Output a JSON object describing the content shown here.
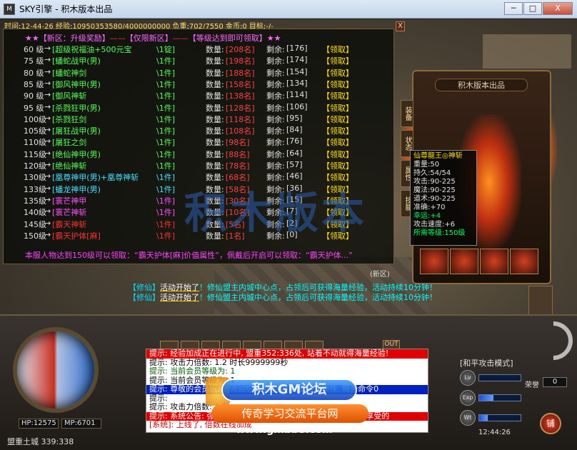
{
  "window": {
    "title": "SKY引擎 - 积木版本出品",
    "min": "─",
    "max": "□",
    "close": "X"
  },
  "status": {
    "time_label": "时间",
    "time": "12-44-26",
    "exp_label": "经验",
    "exp": "10950353580/4000000000",
    "weight_label": "负重",
    "weight": "702/7550",
    "gold_label": "金币",
    "gold": "0",
    "target_label": "目标",
    "target": "-/-"
  },
  "panel": {
    "close": "X",
    "header_star1": "★★",
    "header_a": "【新区：升级奖励】",
    "header_dash1": "——",
    "header_b": "【仅限新区】",
    "header_dash2": "——",
    "header_c": "【等级达到即可领取】",
    "header_star2": "★★",
    "count_label": "数量:",
    "remain_label": "剩余:",
    "rows": [
      {
        "lv": "60 级",
        "item": "[超级祝福油+500元宝",
        "qty": "\\1锭]",
        "cnt": "[208名]",
        "rem": "[176]",
        "claim": "【领取】",
        "color": "#50ff50"
      },
      {
        "lv": "75 级",
        "item": "[蟠蛇战甲(男)",
        "qty": "\\1件]",
        "cnt": "[198名]",
        "rem": "[174]",
        "claim": "【领取】",
        "color": "#50ff50"
      },
      {
        "lv": "80 级",
        "item": "[蟠蛇神剑",
        "qty": "\\1件]",
        "cnt": "[188名]",
        "rem": "[154]",
        "claim": "【领取】",
        "color": "#50ff50"
      },
      {
        "lv": "85 级",
        "item": "[御风神甲(男)",
        "qty": "\\1件]",
        "cnt": "[158名]",
        "rem": "[134]",
        "claim": "【领取】",
        "color": "#50ff50"
      },
      {
        "lv": "90 级",
        "item": "[御风神斩",
        "qty": "\\1件]",
        "cnt": "[138名]",
        "rem": "[114]",
        "claim": "【领取】",
        "color": "#50ff50"
      },
      {
        "lv": "95 级",
        "item": "[杀戮狂甲(男)",
        "qty": "\\1件]",
        "cnt": "[128名]",
        "rem": "[106]",
        "claim": "【领取】",
        "color": "#50ff50"
      },
      {
        "lv": "100级",
        "item": "[杀戮狂剑",
        "qty": "\\1件]",
        "cnt": "[118名]",
        "rem": "[95]",
        "claim": "【领取】",
        "color": "#50ff50"
      },
      {
        "lv": "105级",
        "item": "[屠狂战甲(男)",
        "qty": "\\1件]",
        "cnt": "[108名]",
        "rem": "[84]",
        "claim": "【领取】",
        "color": "#50ff50"
      },
      {
        "lv": "110级",
        "item": "[屠狂之剑",
        "qty": "\\1件]",
        "cnt": "[98名]",
        "rem": "[76]",
        "claim": "【领取】",
        "color": "#50ff50"
      },
      {
        "lv": "115级",
        "item": "[绝仙神甲(男)",
        "qty": "\\1件]",
        "cnt": "[88名]",
        "rem": "[64]",
        "claim": "【领取】",
        "color": "#50ff50"
      },
      {
        "lv": "120级",
        "item": "[绝仙神斩",
        "qty": "\\1件]",
        "cnt": "[78名]",
        "rem": "[57]",
        "claim": "【领取】",
        "color": "#50ff50"
      },
      {
        "lv": "130级",
        "item": "[凰尊神甲(男)+凰尊神斩",
        "qty": "\\1件]",
        "cnt": "[68名]",
        "rem": "[46]",
        "claim": "【领取】",
        "color": "#40e0ff"
      },
      {
        "lv": "133级",
        "item": "[蟠龙神甲(男)",
        "qty": "\\1件]",
        "cnt": "[58名]",
        "rem": "[36]",
        "claim": "【领取】",
        "color": "#40e0ff"
      },
      {
        "lv": "135级",
        "item": "[寰芒神甲",
        "qty": "\\1件]",
        "cnt": "[30名]",
        "rem": "[15]",
        "claim": "【领取】",
        "color": "#ff50ff"
      },
      {
        "lv": "140级",
        "item": "[寰芒神斩",
        "qty": "\\1件]",
        "cnt": "[10名]",
        "rem": "[7]",
        "claim": "【领取】",
        "color": "#ff50ff"
      },
      {
        "lv": "145级",
        "item": "[霸天神斩",
        "qty": "\\1件]",
        "cnt": "[5名]",
        "rem": "[2]",
        "claim": "【领取】",
        "color": "#ff3030"
      },
      {
        "lv": "150级",
        "item": "[霸天护体[麻]",
        "qty": "\\1件]",
        "cnt": "[1名]",
        "rem": "[0]",
        "claim": "【领取】",
        "color": "#ff3030"
      }
    ],
    "footer": "本服人物达到150级可以领取：“霸天护体[麻]价值属性”，佩戴后开启可以领取：“霸天护体...”"
  },
  "equip": {
    "title": "积木版本出品",
    "tab1": "装备",
    "tab2": "状态",
    "tab3": "属性",
    "tab4": "技能",
    "tooltip": {
      "name": "仙尊龍王◎神斩",
      "lines": [
        "重量:50",
        "持久:54/54",
        "攻击:90-225",
        "魔法:90-225",
        "道术:90-225",
        "准确:+70"
      ],
      "luck": "幸运:+4",
      "speed": "攻击速度:+6",
      "need": "所需等级:150级"
    }
  },
  "announce": [
    {
      "tag": "【修仙】",
      "act": "活动开始了",
      "body": "！修仙盟主内城中心点，占领后可获得海量经验，活动持续10分钟！"
    },
    {
      "tag": "【修仙】",
      "act": "活动开始了",
      "body": "！修仙盟主内城中心点，占领后可获得海量经验，活动持续10分钟！"
    }
  ],
  "namelabel": "(新区)",
  "hud": {
    "hp": "HP:12575",
    "mp": "MP:6701",
    "map": "盟重土城",
    "coords": "339:338",
    "out": "OUT",
    "mode": "[和平攻击模式]",
    "custom": "荣誉",
    "custom_value": "0",
    "clock": "12:44:26",
    "shop": "铺",
    "btn1": "Lv",
    "btn2": "Exp",
    "btn3": "Wt"
  },
  "chat": [
    {
      "cls": "red",
      "text": "提示: 经验加成正在进行中, 盟重352:336处, 站着不动就得海量经验!"
    },
    {
      "cls": "blk",
      "text": "提示: 攻击力倍数: 1.2 时长9999999秒"
    },
    {
      "cls": "gr",
      "text": "提示: 当前会员等级为: 1"
    },
    {
      "cls": "blk",
      "text": "提示: 当前会员等级为: 1"
    },
    {
      "cls": "blu",
      "text": "提示: 尊敬的会员玩家, 欢迎您来到本服, 祝您游戏愉快, 服务命令0"
    },
    {
      "cls": "blk",
      "text": "提示:"
    },
    {
      "cls": "blk",
      "text": "提示: 攻击力倍数: 1.2"
    },
    {
      "cls": "red",
      "text": "提示: 系统公告: 强力经验时间开启, 盟重土城中心点, 现在开启享受的"
    },
    {
      "cls": "rt",
      "text": "[系统]: 上线了, 倍数在线加成"
    }
  ],
  "watermark": {
    "line1": "积木GM论坛",
    "line2": "传奇学习交流平台网",
    "line3": "www.gmbb8.com",
    "center": "积木版本"
  }
}
